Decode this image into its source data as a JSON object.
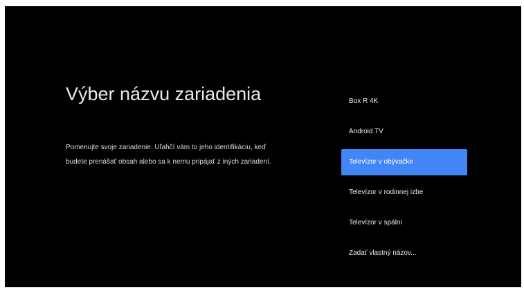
{
  "page": {
    "title": "Výber názvu zariadenia",
    "description_line1": "Pomenujte svoje zariadenie. Uľahčí vám to jeho identifikáciu, keď",
    "description_line2": "budete prenášať obsah alebo sa k nemu pripájať z iných zariadení."
  },
  "options": [
    {
      "label": "Box R 4K",
      "selected": false
    },
    {
      "label": "Android TV",
      "selected": false
    },
    {
      "label": "Televízor v obývačke",
      "selected": true
    },
    {
      "label": "Televízor v rodinnej izbe",
      "selected": false
    },
    {
      "label": "Televízor v spálni",
      "selected": false
    },
    {
      "label": "Zadať vlastný názov...",
      "selected": false
    }
  ],
  "colors": {
    "background": "#000000",
    "accent": "#4285f4",
    "text": "#e8eaed"
  }
}
